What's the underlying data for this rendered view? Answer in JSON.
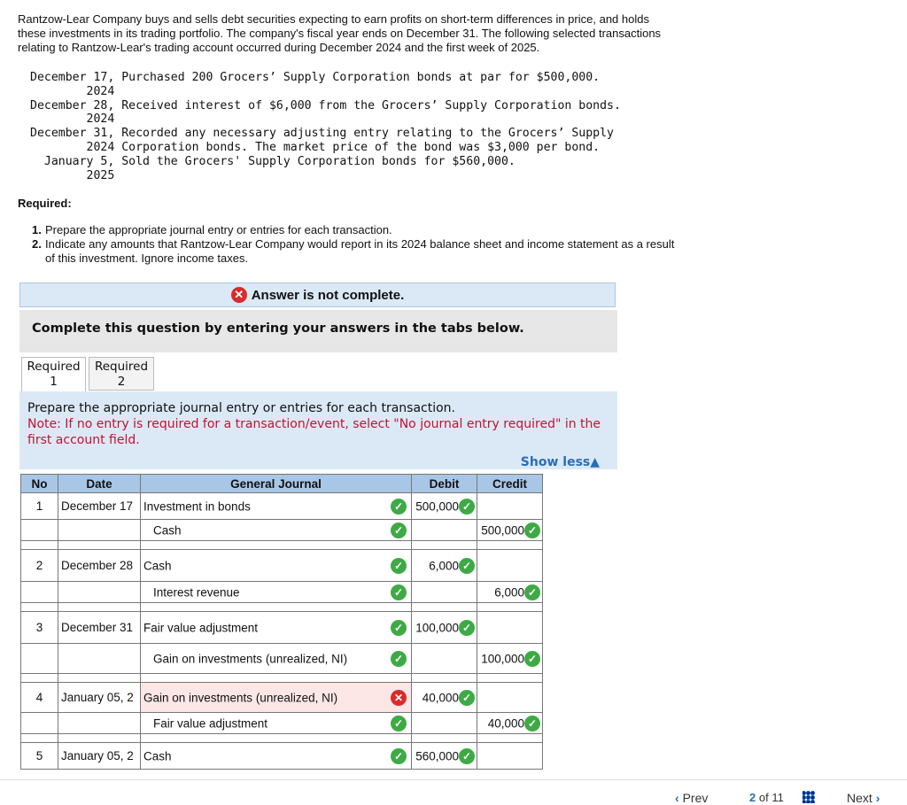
{
  "intro": "Rantzow-Lear Company buys and sells debt securities expecting to earn profits on short-term differences in price, and holds these investments in its trading portfolio. The company's fiscal year ends on December 31. The following selected transactions relating to Rantzow-Lear's trading account occurred during December 2024 and the first week of 2025.",
  "transactions_text": "December 17, Purchased 200 Grocers’ Supply Corporation bonds at par for $500,000.\n        2024\nDecember 28, Received interest of $6,000 from the Grocers’ Supply Corporation bonds.\n        2024\nDecember 31, Recorded any necessary adjusting entry relating to the Grocers’ Supply\n        2024 Corporation bonds. The market price of the bond was $3,000 per bond.\n  January 5, Sold the Grocers' Supply Corporation bonds for $560,000.\n        2025",
  "required_heading": "Required:",
  "required": [
    {
      "num": "1.",
      "text": "Prepare the appropriate journal entry or entries for each transaction."
    },
    {
      "num": "2.",
      "text": "Indicate any amounts that Rantzow-Lear Company would report in its 2024 balance sheet and income statement as a result of this investment. Ignore income taxes."
    }
  ],
  "banner": "Answer is not complete.",
  "instructions": "Complete this question by entering your answers in the tabs below.",
  "tabs": [
    {
      "line1": "Required",
      "line2": "1"
    },
    {
      "line1": "Required",
      "line2": "2"
    }
  ],
  "panel": {
    "prompt": "Prepare the appropriate journal entry or entries for each transaction.",
    "note": "Note: If no entry is required for a transaction/event, select \"No journal entry required\" in the first account field.",
    "show_less": "Show less▲"
  },
  "table": {
    "headers": [
      "No",
      "Date",
      "General Journal",
      "Debit",
      "Credit"
    ],
    "entries": [
      {
        "no": "1",
        "date": "December 17",
        "lines": [
          {
            "account": "Investment in bonds",
            "indent": false,
            "status": "ok",
            "debit": "500,000",
            "credit": ""
          },
          {
            "account": "Cash",
            "indent": true,
            "status": "ok",
            "debit": "",
            "credit": "500,000"
          }
        ]
      },
      {
        "no": "2",
        "date": "December 28",
        "lines": [
          {
            "account": "Cash",
            "indent": false,
            "status": "ok",
            "debit": "6,000",
            "credit": ""
          },
          {
            "account": "Interest revenue",
            "indent": true,
            "status": "ok",
            "debit": "",
            "credit": "6,000"
          }
        ]
      },
      {
        "no": "3",
        "date": "December 31",
        "lines": [
          {
            "account": "Fair value adjustment",
            "indent": false,
            "status": "ok",
            "debit": "100,000",
            "credit": ""
          },
          {
            "account": "Gain on investments (unrealized, NI)",
            "indent": true,
            "status": "ok",
            "debit": "",
            "credit": "100,000"
          }
        ]
      },
      {
        "no": "4",
        "date": "January 05, 2",
        "lines": [
          {
            "account": "Gain on investments (unrealized, NI)",
            "indent": false,
            "status": "bad",
            "debit": "40,000",
            "credit": ""
          },
          {
            "account": "Fair value adjustment",
            "indent": true,
            "status": "ok",
            "debit": "",
            "credit": "40,000"
          }
        ]
      },
      {
        "no": "5",
        "date": "January 05, 2",
        "lines": [
          {
            "account": "Cash",
            "indent": false,
            "status": "ok",
            "debit": "560,000",
            "credit": ""
          }
        ]
      }
    ]
  },
  "nav": {
    "prev": "Prev",
    "page": "2",
    "of": "of 11",
    "next": "Next"
  },
  "colors": {
    "header_bg": "#a8c6e6",
    "panel_bg": "#dbe9f6",
    "ok": "#3eaa45",
    "bad": "#d92b2b",
    "note": "#c8102e",
    "link": "#2a6db8"
  }
}
